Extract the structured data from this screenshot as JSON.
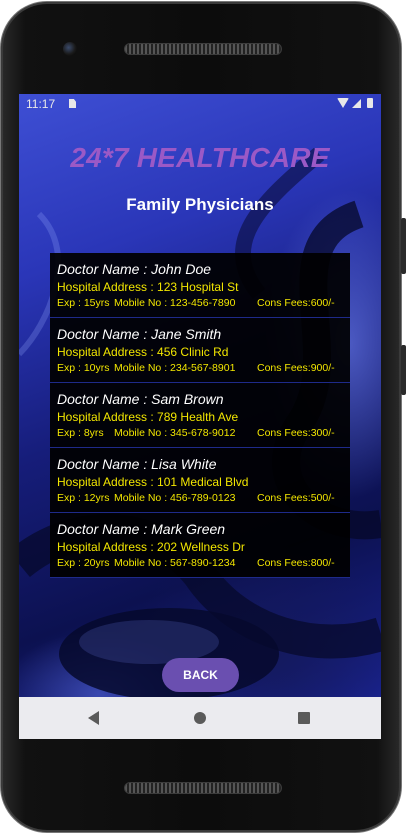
{
  "status_bar": {
    "time": "11:17",
    "icons": [
      "sim-card-icon",
      "wifi-icon",
      "signal-icon",
      "battery-icon"
    ]
  },
  "app": {
    "title": "24*7 HEALTHCARE",
    "subtitle": "Family Physicians",
    "title_color": "#9b59c6",
    "accent_text_color": "#f2e600"
  },
  "doctors": [
    {
      "name": "Doctor Name : John Doe",
      "address": "Hospital Address : 123 Hospital St",
      "exp": "Exp : 15yrs",
      "mobile": "Mobile No : 123-456-7890",
      "fees": "Cons Fees:600/-"
    },
    {
      "name": "Doctor Name : Jane Smith",
      "address": "Hospital Address : 456 Clinic Rd",
      "exp": "Exp : 10yrs",
      "mobile": "Mobile No : 234-567-8901",
      "fees": "Cons Fees:900/-"
    },
    {
      "name": "Doctor Name : Sam Brown",
      "address": "Hospital Address : 789 Health Ave",
      "exp": "Exp : 8yrs",
      "mobile": "Mobile No : 345-678-9012",
      "fees": "Cons Fees:300/-"
    },
    {
      "name": "Doctor Name : Lisa White",
      "address": "Hospital Address : 101 Medical Blvd",
      "exp": "Exp : 12yrs",
      "mobile": "Mobile No : 456-789-0123",
      "fees": "Cons Fees:500/-"
    },
    {
      "name": "Doctor Name : Mark Green",
      "address": "Hospital Address : 202 Wellness Dr",
      "exp": "Exp : 20yrs",
      "mobile": "Mobile No : 567-890-1234",
      "fees": "Cons Fees:800/-"
    }
  ],
  "back_button": {
    "label": "BACK",
    "color": "#6a4fb0"
  },
  "nav_bar": {
    "icons": [
      "back-triangle-icon",
      "home-circle-icon",
      "recents-square-icon"
    ]
  }
}
